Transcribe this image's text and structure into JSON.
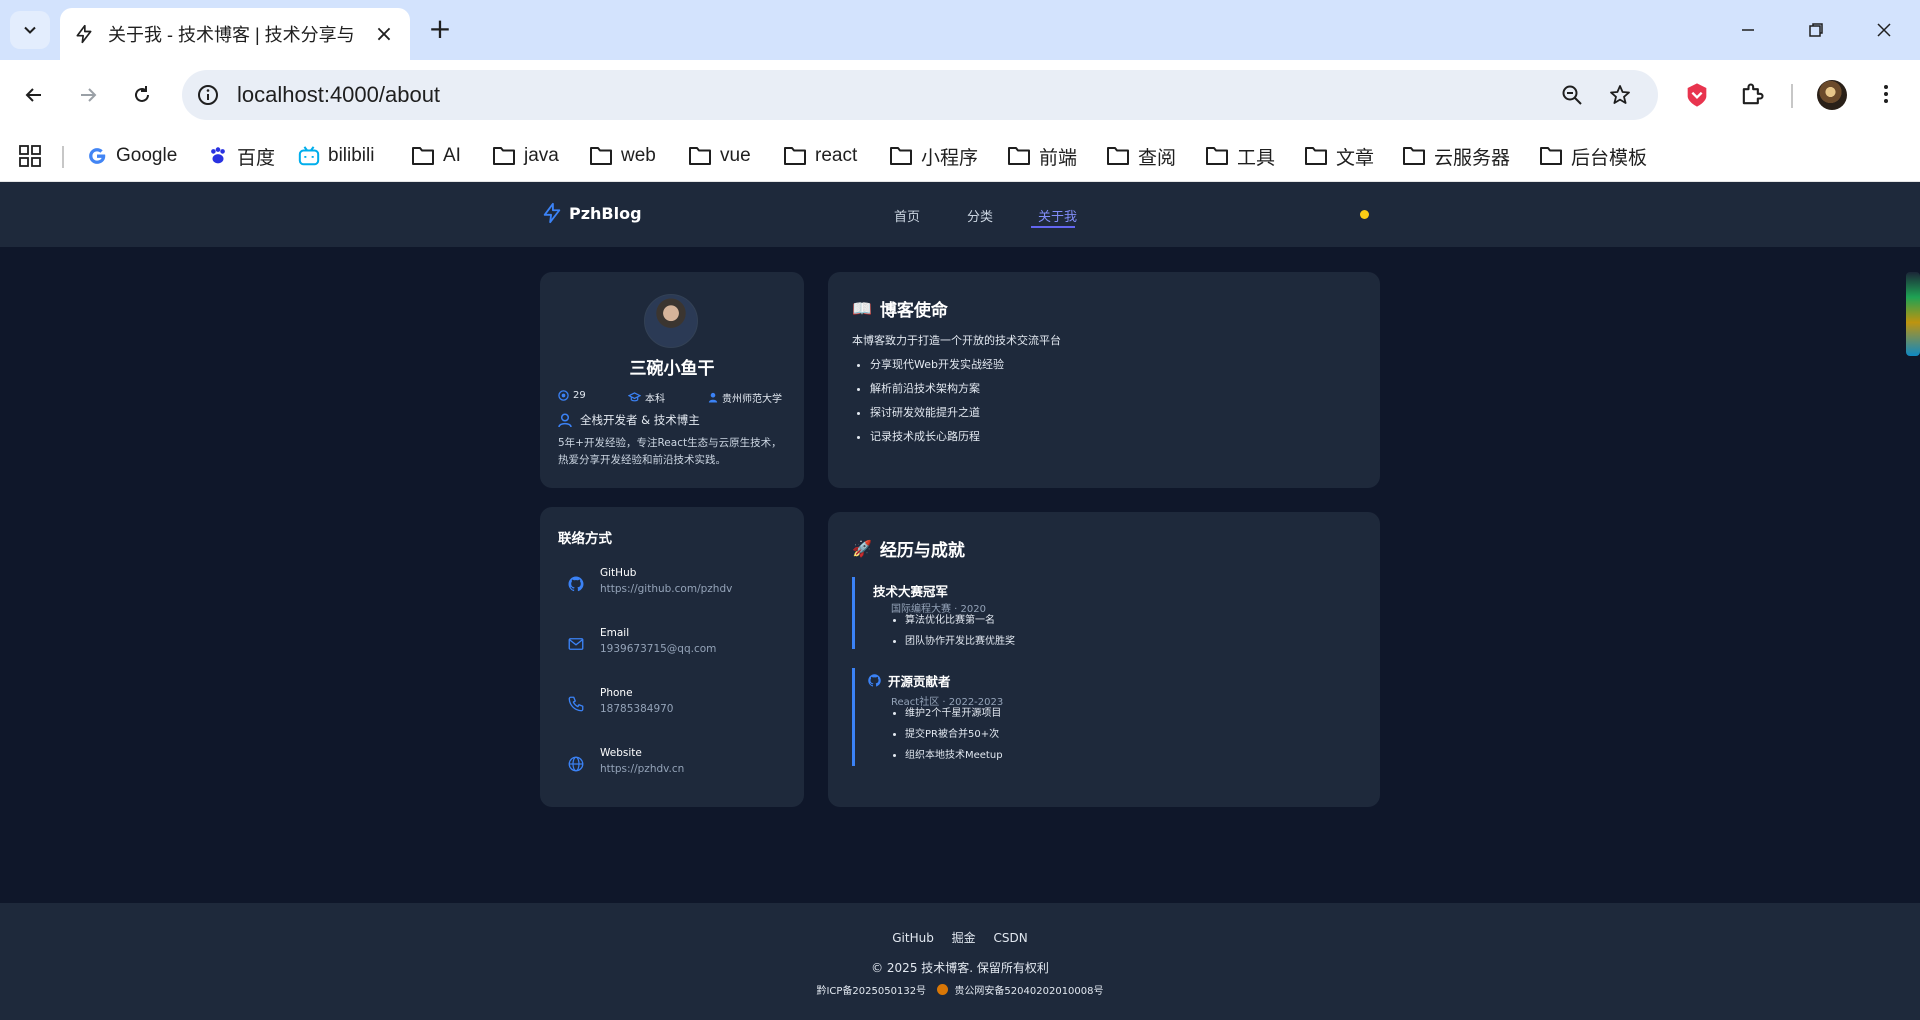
{
  "browser": {
    "tab_title": "关于我 - 技术博客 | 技术分享与",
    "url": "localhost:4000/about",
    "bookmarks": [
      "Google",
      "百度",
      "bilibili",
      "AI",
      "java",
      "web",
      "vue",
      "react",
      "小程序",
      "前端",
      "查阅",
      "工具",
      "文章",
      "云服务器",
      "后台模板"
    ]
  },
  "site": {
    "logo": "PzhBlog",
    "nav": [
      "首页",
      "分类",
      "关于我"
    ],
    "active_nav": "关于我"
  },
  "profile": {
    "name": "三碗小鱼干",
    "age": "29",
    "degree": "本科",
    "school": "贵州师范大学",
    "role": "全栈开发者 & 技术博主",
    "bio": "5年+开发经验，专注React生态与云原生技术，热爱分享开发经验和前沿技术实践。"
  },
  "contact": {
    "title": "联络方式",
    "items": [
      {
        "label": "GitHub",
        "value": "https://github.com/pzhdv",
        "icon": "github-icon"
      },
      {
        "label": "Email",
        "value": "1939673715@qq.com",
        "icon": "mail-icon"
      },
      {
        "label": "Phone",
        "value": "18785384970",
        "icon": "phone-icon"
      },
      {
        "label": "Website",
        "value": "https://pzhdv.cn",
        "icon": "globe-icon"
      }
    ]
  },
  "mission": {
    "emoji": "📖",
    "title": "博客使命",
    "intro": "本博客致力于打造一个开放的技术交流平台",
    "items": [
      "分享现代Web开发实战经验",
      "解析前沿技术架构方案",
      "探讨研发效能提升之道",
      "记录技术成长心路历程"
    ]
  },
  "experience": {
    "emoji": "🚀",
    "title": "经历与成就",
    "entries": [
      {
        "title": "技术大赛冠军",
        "sub": "国际编程大赛 · 2020",
        "items": [
          "算法优化比赛第一名",
          "团队协作开发比赛优胜奖"
        ]
      },
      {
        "title": "开源贡献者",
        "sub": "React社区 · 2022-2023",
        "items": [
          "维护2个千星开源项目",
          "提交PR被合并50+次",
          "组织本地技术Meetup"
        ]
      }
    ]
  },
  "footer": {
    "links": [
      "GitHub",
      "掘金",
      "CSDN"
    ],
    "copyright": "© 2025 技术博客. 保留所有权利",
    "icp": "黔ICP备2025050132号",
    "police": "贵公网安备52040202010008号"
  },
  "colors": {
    "accent": "#3b82f6",
    "bg": "#0f172a",
    "card": "#1e293b",
    "nav_active": "#818cf8"
  }
}
